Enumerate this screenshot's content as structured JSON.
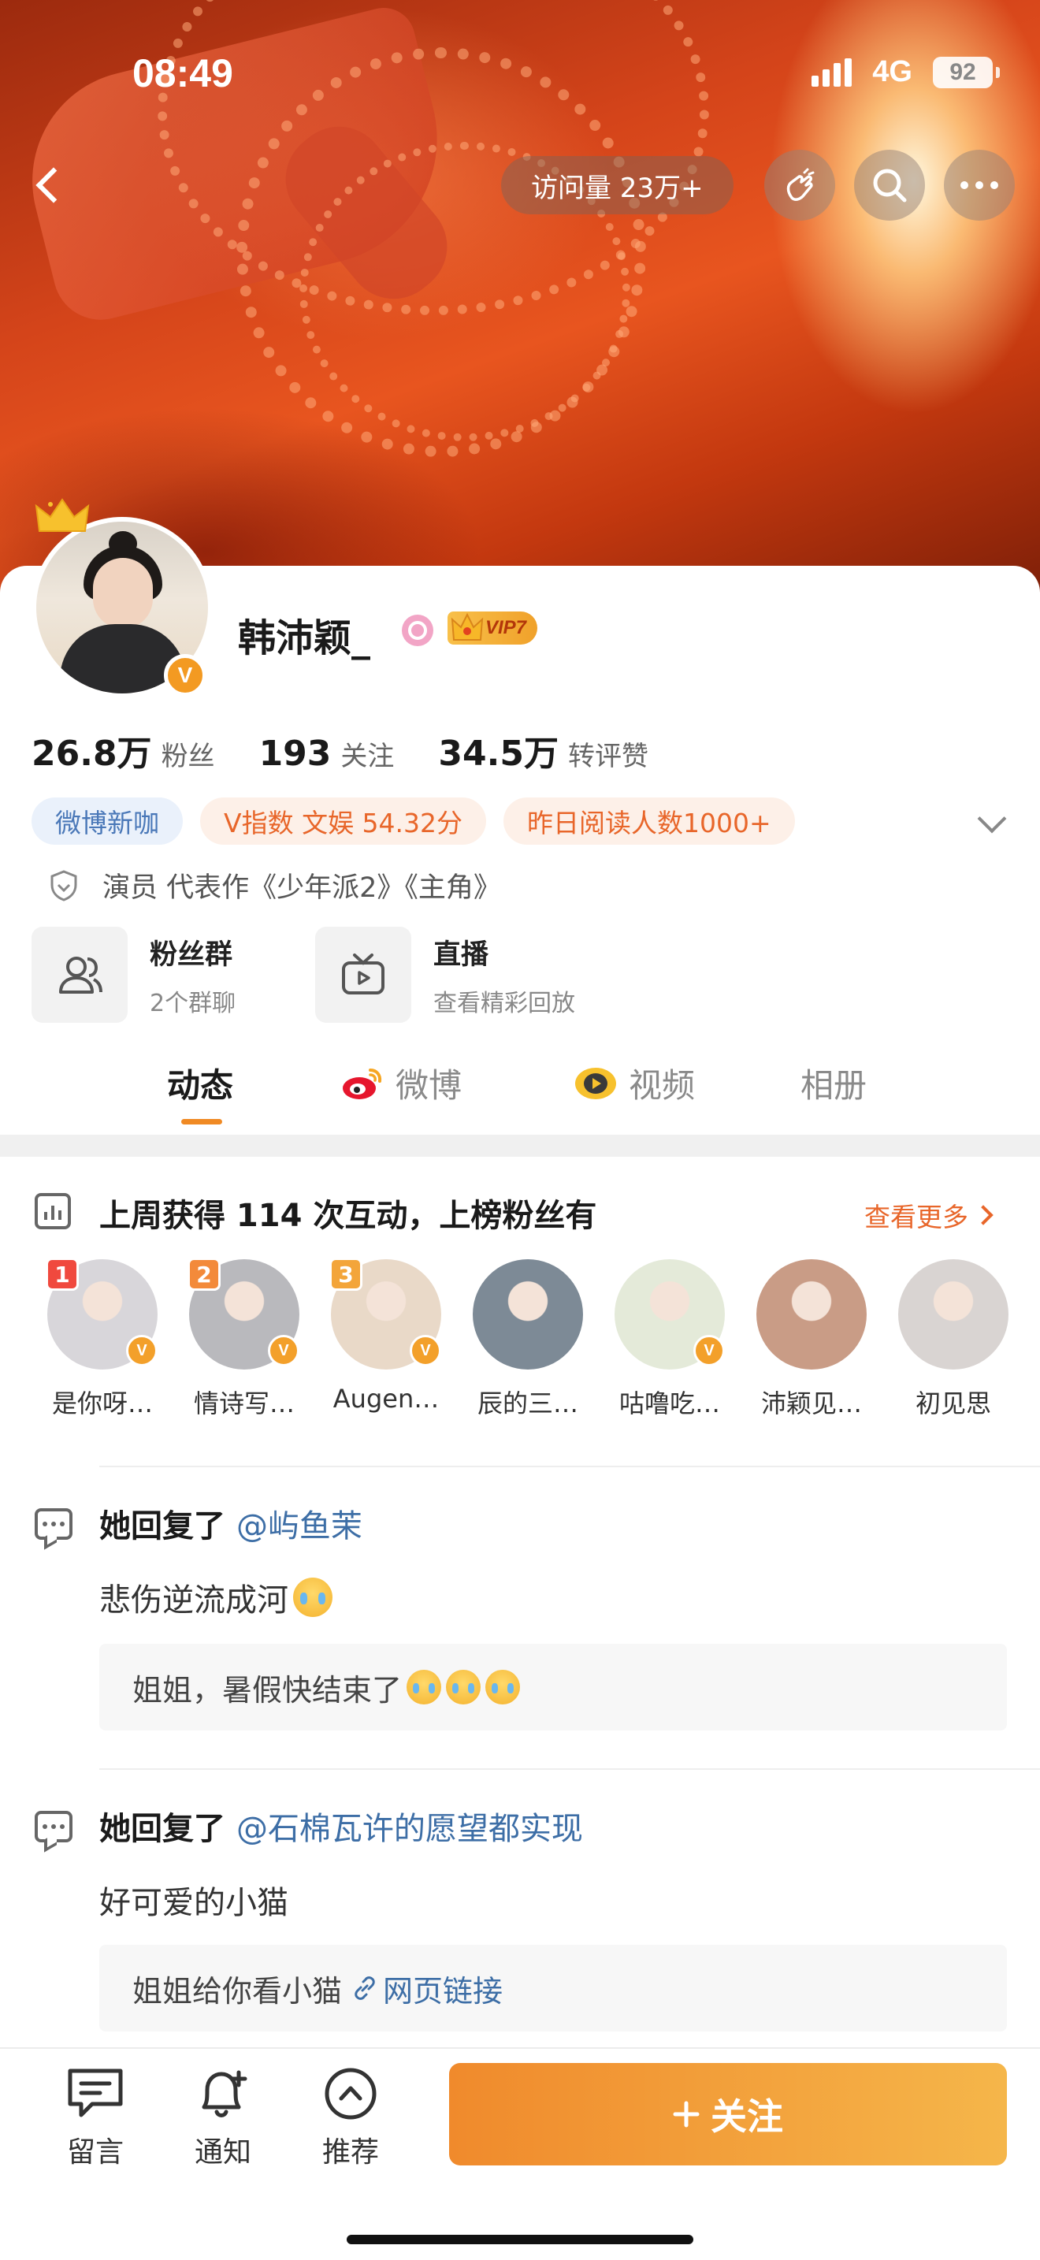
{
  "status_bar": {
    "time": "08:49",
    "network": "4G",
    "battery": "92"
  },
  "header": {
    "visits": "访问量 23万+"
  },
  "profile": {
    "name": "韩沛颖_",
    "vip_label": "VIP7",
    "verified_mark": "V",
    "stats": [
      {
        "value": "26.8万",
        "label": "粉丝"
      },
      {
        "value": "193",
        "label": "关注"
      },
      {
        "value": "34.5万",
        "label": "转评赞"
      }
    ],
    "tags": [
      "微博新咖",
      "V指数 文娱 54.32分",
      "昨日阅读人数1000+"
    ],
    "bio": "演员 代表作《少年派2》《主角》",
    "quick_links": [
      {
        "title": "粉丝群",
        "subtitle": "2个群聊"
      },
      {
        "title": "直播",
        "subtitle": "查看精彩回放"
      }
    ]
  },
  "tabs": [
    "动态",
    "微博",
    "视频",
    "相册"
  ],
  "interaction": {
    "title": "上周获得 114 次互动，上榜粉丝有",
    "see_more": "查看更多",
    "fans": [
      {
        "rank": "1",
        "name": "是你呀…",
        "verified": true,
        "color": "#d8d6da"
      },
      {
        "rank": "2",
        "name": "情诗写…",
        "verified": true,
        "color": "#b9b9bd"
      },
      {
        "rank": "3",
        "name": "Augen…",
        "verified": true,
        "color": "#e9d9c8"
      },
      {
        "rank": "",
        "name": "辰的三…",
        "verified": false,
        "color": "#7d8a96"
      },
      {
        "rank": "",
        "name": "咕噜吃…",
        "verified": true,
        "color": "#e4ead9"
      },
      {
        "rank": "",
        "name": "沛颖见…",
        "verified": false,
        "color": "#c99c86"
      },
      {
        "rank": "",
        "name": "初见思",
        "verified": false,
        "color": "#d9d4d2"
      }
    ]
  },
  "posts": [
    {
      "prefix": "她回复了",
      "mention": "@屿鱼茉",
      "body": "悲伤逆流成河",
      "quote": "姐姐，暑假快结束了",
      "quote_link": ""
    },
    {
      "prefix": "她回复了",
      "mention": "@石棉瓦许的愿望都实现",
      "body": "好可爱的小猫",
      "quote": "姐姐给你看小猫",
      "quote_link": "网页链接"
    }
  ],
  "bottom_bar": {
    "message": "留言",
    "notify": "通知",
    "recommend": "推荐",
    "follow": "关注"
  },
  "colors": {
    "accent": "#f08a24",
    "link": "#3d6ea6",
    "tag_orange": "#e8662a"
  }
}
